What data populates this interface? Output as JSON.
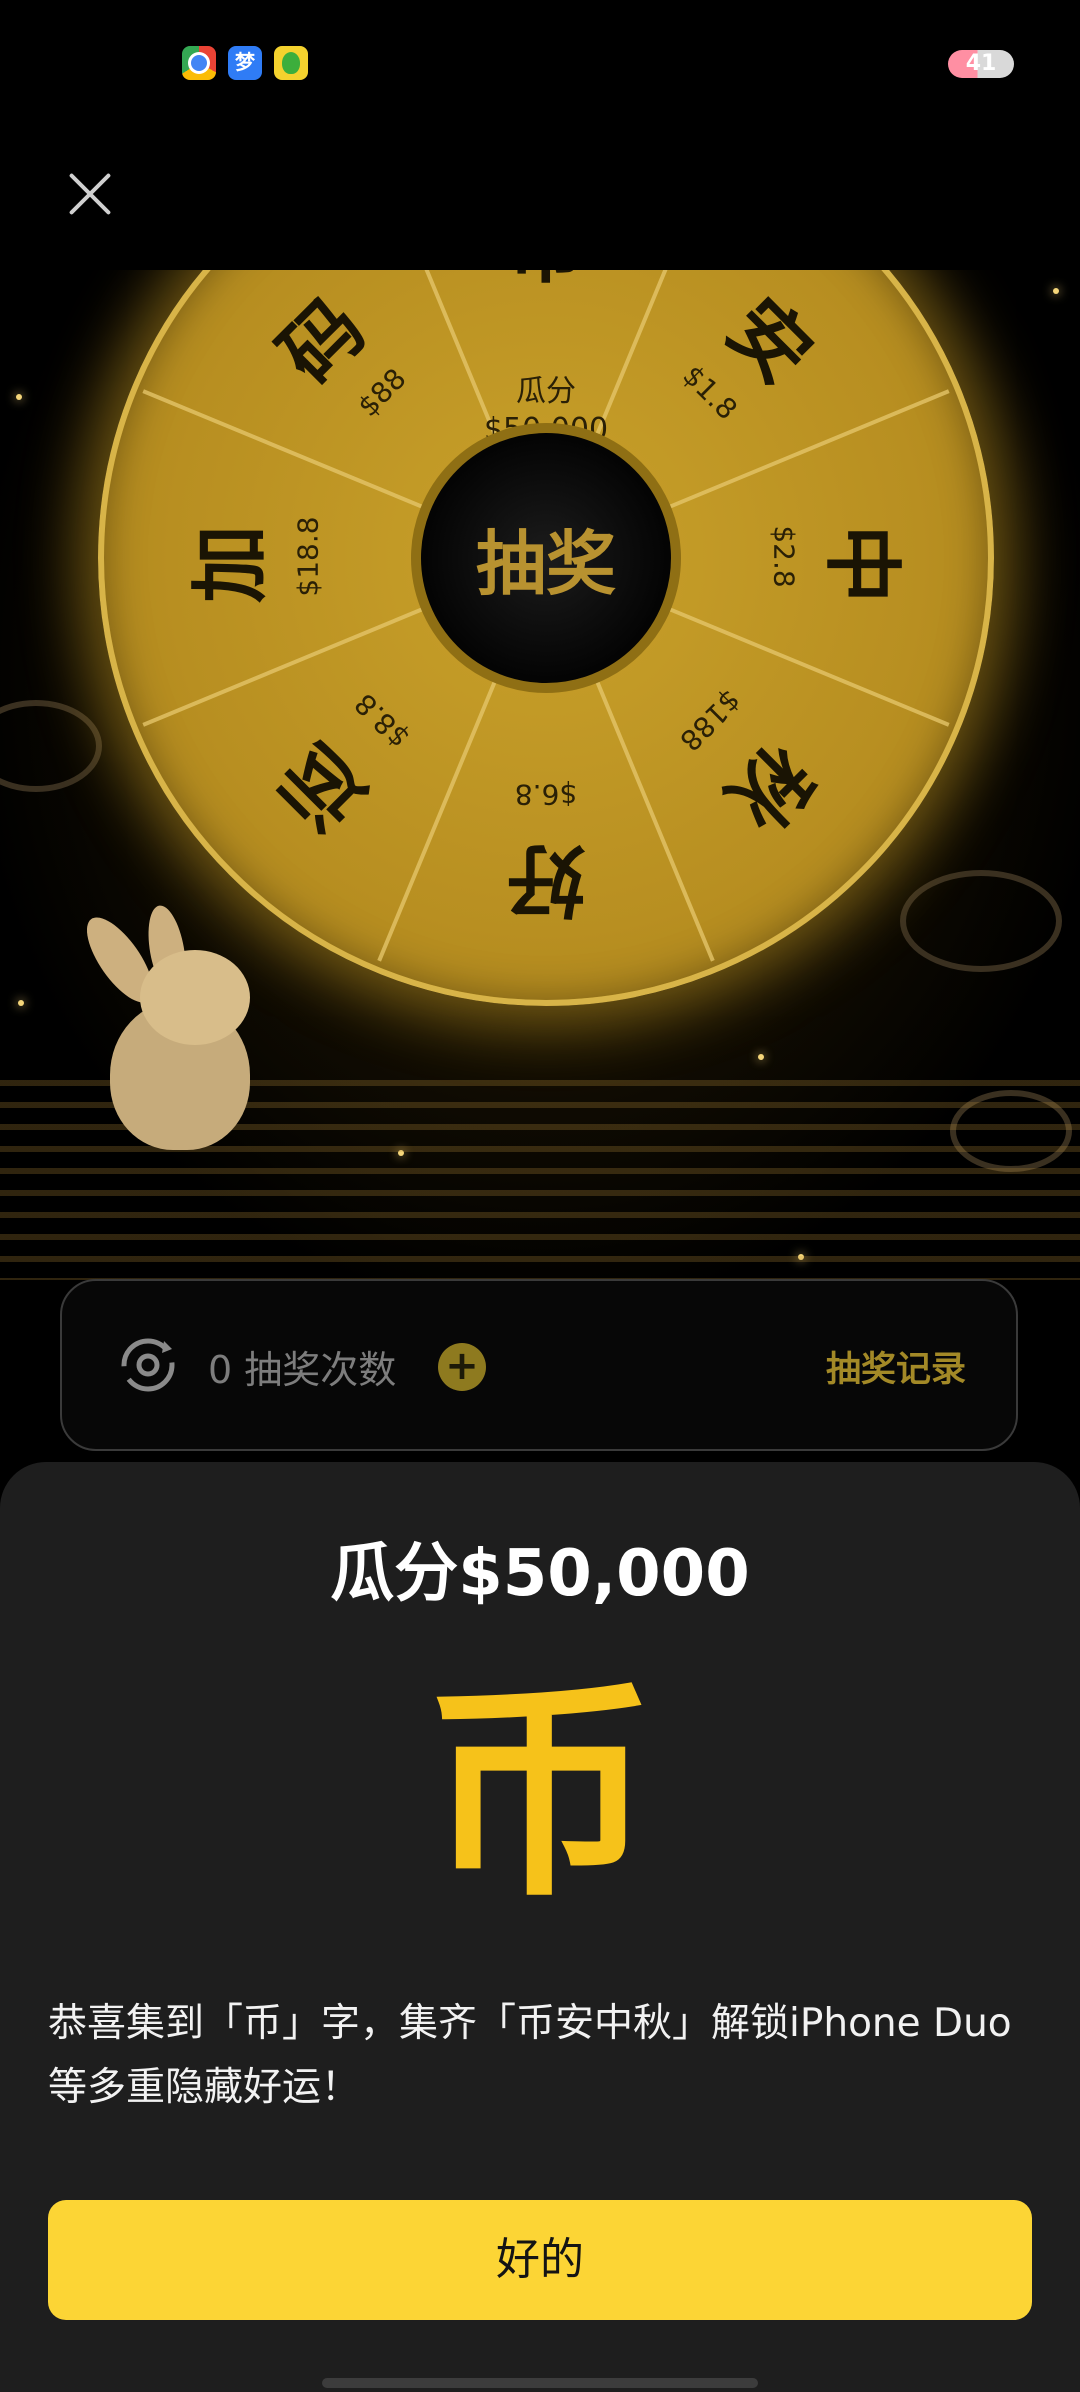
{
  "status_bar": {
    "apps": [
      {
        "icon": "chrome-icon"
      },
      {
        "icon": "blue-app-icon",
        "glyph": "梦"
      },
      {
        "icon": "green-app-icon"
      }
    ],
    "battery_level": "41"
  },
  "wheel": {
    "hub_label": "抽奖",
    "segments": [
      {
        "char": "币",
        "amount": "瓜分\n$50,000"
      },
      {
        "char": "安",
        "amount": "$1.8"
      },
      {
        "char": "中",
        "amount": "$2.8"
      },
      {
        "char": "秋",
        "amount": "$188"
      },
      {
        "char": "好",
        "amount": "$6.8"
      },
      {
        "char": "运",
        "amount": "$8.8"
      },
      {
        "char": "加",
        "amount": "$18.8"
      },
      {
        "char": "码",
        "amount": "$88"
      }
    ]
  },
  "draw_bar": {
    "count_text": "0 抽奖次数",
    "add_symbol": "+",
    "record_label": "抽奖记录"
  },
  "dialog": {
    "title": "瓜分$50,000",
    "char": "币",
    "message": "恭喜集到「币」字，集齐「币安中秋」解锁iPhone Duo等多重隐藏好运！",
    "ok_label": "好的"
  },
  "colors": {
    "accent": "#fcd535",
    "wheel_gold": "#c9a12a",
    "dialog_bg": "#1e1e1e"
  }
}
